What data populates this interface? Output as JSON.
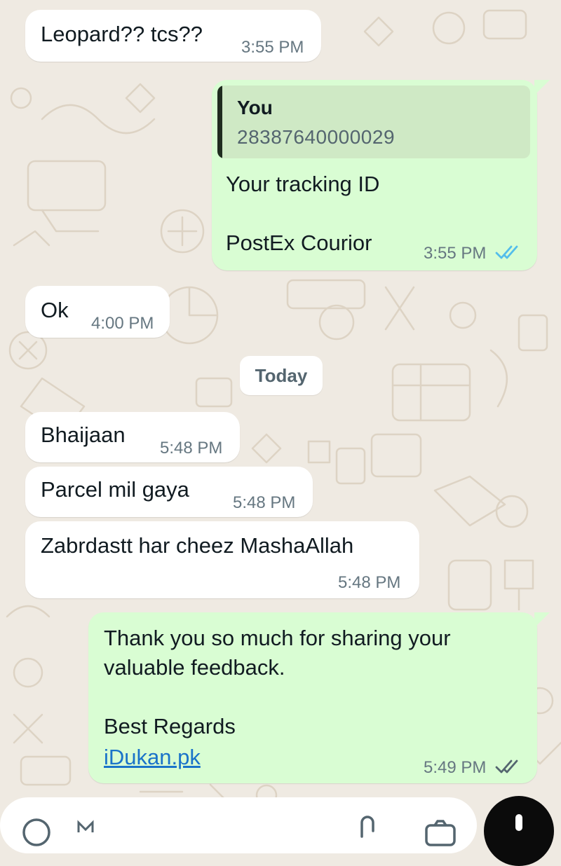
{
  "chat": {
    "messages": [
      {
        "direction": "incoming",
        "text": "Leopard?? tcs??",
        "time": "3:55 PM"
      },
      {
        "direction": "outgoing",
        "reply_to": {
          "author": "You",
          "text": "28387640000029"
        },
        "lines": [
          "Your tracking ID",
          "PostEx Courior"
        ],
        "time": "3:55 PM",
        "status": "read"
      },
      {
        "direction": "incoming",
        "text": "Ok",
        "time": "4:00 PM"
      },
      {
        "direction": "incoming",
        "text": "Bhaijaan",
        "time": "5:48 PM"
      },
      {
        "direction": "incoming",
        "text": "Parcel mil gaya",
        "time": "5:48 PM"
      },
      {
        "direction": "incoming",
        "text": "Zabrdastt har cheez MashaAllah",
        "time": "5:48 PM"
      },
      {
        "direction": "outgoing",
        "lines": [
          "Thank you so much for sharing your",
          "valuable feedback.",
          "Best Regards"
        ],
        "link": "iDukan.pk",
        "time": "5:49 PM",
        "status": "delivered"
      }
    ],
    "date_separator": "Today"
  },
  "composer": {
    "left_icon": "emoji-icon",
    "right_icons": [
      "attach-icon",
      "camera-icon"
    ],
    "action_icon": "mic-icon"
  },
  "colors": {
    "background": "#efeae2",
    "incoming_bubble": "#ffffff",
    "outgoing_bubble": "#d9fdd3",
    "read_ticks": "#53bdeb",
    "link": "#1a73c9"
  }
}
